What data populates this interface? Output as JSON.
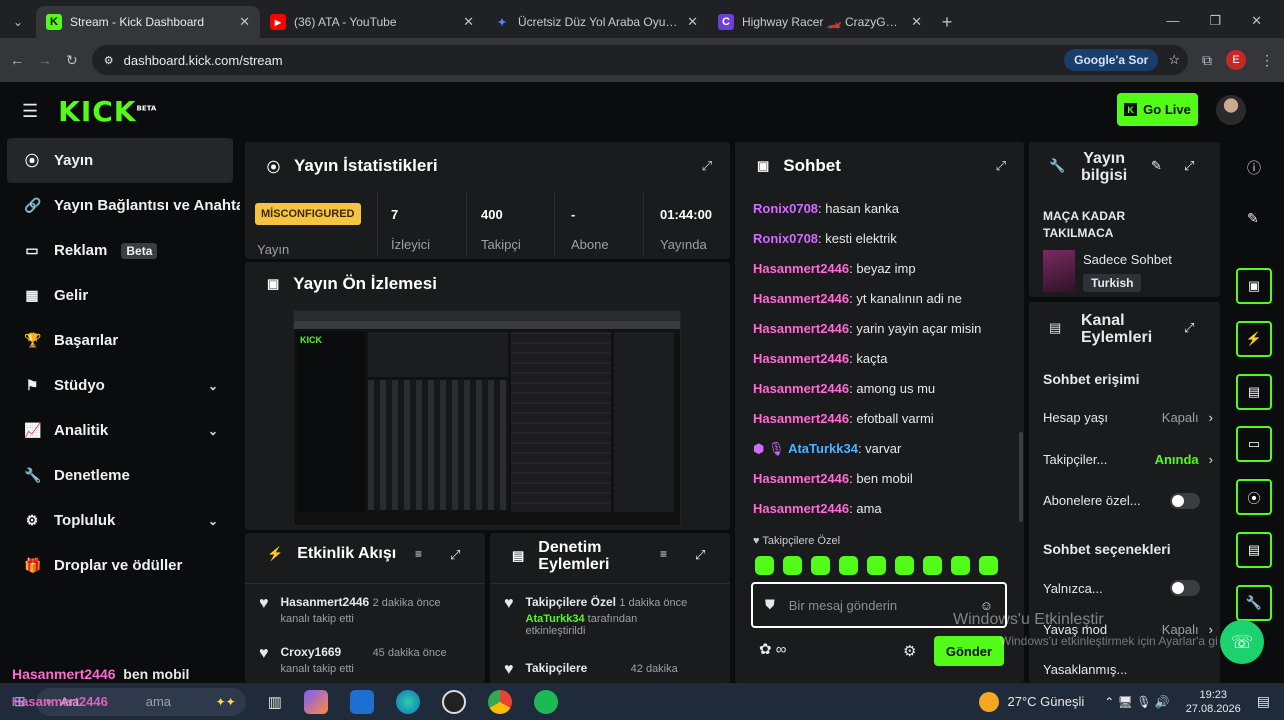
{
  "browser": {
    "tabs": [
      {
        "title": "Stream - Kick Dashboard",
        "fav": "K",
        "fav_color": "#53fc18",
        "active": true
      },
      {
        "title": "(36) ATA - YouTube",
        "fav": "▶",
        "fav_color": "#ff0000",
        "active": false
      },
      {
        "title": "Ücretsiz Düz Yol Araba Oyunları",
        "fav": "✦",
        "fav_color": "#4a8af4",
        "active": false
      },
      {
        "title": "Highway Racer 🏎️ CrazyGames",
        "fav": "C",
        "fav_color": "#6b3fd8",
        "active": false
      }
    ],
    "new_tab": "+",
    "url": "dashboard.kick.com/stream",
    "google_button": "Google'a Sor",
    "profile_initial": "E"
  },
  "header": {
    "logo": "KICK",
    "logo_sup": "BETA",
    "go_live": "Go Live"
  },
  "sidebar": {
    "items": [
      {
        "label": "Yayın",
        "icon": "⦿",
        "chev": ""
      },
      {
        "label": "Yayın Bağlantısı ve Anahtar",
        "icon": "🔗",
        "chev": ""
      },
      {
        "label": "Reklam",
        "icon": "▭",
        "chev": "",
        "badge": "Beta"
      },
      {
        "label": "Gelir",
        "icon": "▦",
        "chev": ""
      },
      {
        "label": "Başarılar",
        "icon": "🏆",
        "chev": ""
      },
      {
        "label": "Stüdyo",
        "icon": "⚑",
        "chev": "⌄"
      },
      {
        "label": "Analitik",
        "icon": "📈",
        "chev": "⌄"
      },
      {
        "label": "Denetleme",
        "icon": "🔧",
        "chev": ""
      },
      {
        "label": "Topluluk",
        "icon": "⚙",
        "chev": "⌄"
      },
      {
        "label": "Droplar ve ödüller",
        "icon": "🎁",
        "chev": ""
      }
    ]
  },
  "stats": {
    "title": "Yayın İstatistikleri",
    "status_badge": "MİSCONFIGURED",
    "status_label": "Yayın",
    "viewers_value": "7",
    "viewers_label": "İzleyici",
    "followers_value": "400",
    "followers_label": "Takipçi",
    "subs_value": "-",
    "subs_label": "Abone",
    "uptime_value": "01:44:00",
    "uptime_label": "Yayında"
  },
  "preview": {
    "title": "Yayın Ön İzlemesi"
  },
  "activity": {
    "title": "Etkinlik Akışı",
    "items": [
      {
        "user": "Hasanmert2446",
        "time": "2 dakika önce",
        "text": "kanalı takip etti"
      },
      {
        "user": "Croxy1669",
        "time": "45 dakika önce",
        "text": "kanalı takip etti"
      }
    ]
  },
  "modactions": {
    "title_line1": "Denetim",
    "title_line2": "Eylemleri",
    "items": [
      {
        "title": "Takipçilere Özel",
        "time": "1 dakika önce",
        "user": "AtaTurkk34",
        "rest": " tarafından",
        "line2": "etkinleştirildi"
      },
      {
        "title": "Takipçilere",
        "time": "42 dakika",
        "user": "",
        "rest": "",
        "line2": ""
      }
    ]
  },
  "chat": {
    "title": "Sohbet",
    "messages": [
      {
        "user": "Ronix0708",
        "text": " hasan kanka",
        "color": "p"
      },
      {
        "user": "Ronix0708",
        "text": " kesti elektrik",
        "color": "p"
      },
      {
        "user": "Hasanmert2446",
        "text": " beyaz imp",
        "color": "g"
      },
      {
        "user": "Hasanmert2446",
        "text": " yt kanalının adi ne",
        "color": "g"
      },
      {
        "user": "Hasanmert2446",
        "text": " yarin yayin açar misin",
        "color": "g"
      },
      {
        "user": "Hasanmert2446",
        "text": " kaçta",
        "color": "g"
      },
      {
        "user": "Hasanmert2446",
        "text": " among us mu",
        "color": "g"
      },
      {
        "user": "Hasanmert2446",
        "text": " efotball varmi",
        "color": "g"
      },
      {
        "user": "AtaTurkk34",
        "text": " varvar",
        "color": "b"
      },
      {
        "user": "Hasanmert2446",
        "text": " ben mobil",
        "color": "g"
      },
      {
        "user": "Hasanmert2446",
        "text": " ama",
        "color": "g"
      }
    ],
    "followers_only": "Takipçilere Özel",
    "input_placeholder": "Bir mesaj gönderin",
    "send_label": "Gönder",
    "infinity": "∞"
  },
  "info": {
    "title_line1": "Yayın",
    "title_line2": "bilgisi",
    "stream_title": "MAÇA KADAR TAKILMACA",
    "category": "Sadece Sohbet",
    "language": "Turkish"
  },
  "channel": {
    "title_line1": "Kanal",
    "title_line2": "Eylemleri",
    "chat_access": "Sohbet erişimi",
    "account_age": "Hesap yaşı",
    "account_age_val": "Kapalı",
    "followers": "Takipçiler...",
    "followers_val": "Anında",
    "subs_only": "Abonelere özel...",
    "chat_options": "Sohbet seçenekleri",
    "only": "Yalnızca...",
    "slow_mode": "Yavaş mod",
    "slow_mode_val": "Kapalı",
    "banned": "Yasaklanmış..."
  },
  "overlay": {
    "line1_user": "Hasanmert2446",
    "line1_text": "ben mobil",
    "line2_user": "Hasanmert2446",
    "line2_text": "ama",
    "activate_title": "Windows'u Etkinleştir",
    "activate_sub": "Windows'u etkinleştirmek için Ayarlar'a gidin."
  },
  "taskbar": {
    "search": "Ara",
    "weather": "27°C  Güneşli",
    "time": "19:23",
    "date": "27.08.2026"
  },
  "colors": {
    "accent": "#53fc18",
    "panel": "#191b1d"
  }
}
